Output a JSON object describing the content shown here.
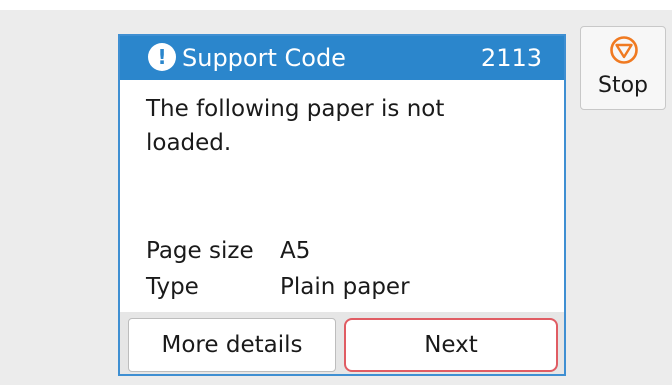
{
  "dialog": {
    "title": "Support Code",
    "code": "2113",
    "message": "The following paper is not loaded.",
    "details": [
      {
        "label": "Page size",
        "value": "A5"
      },
      {
        "label": "Type",
        "value": "Plain paper"
      }
    ],
    "buttons": {
      "more_details": "More details",
      "next": "Next"
    }
  },
  "stop": {
    "label": "Stop"
  },
  "icons": {
    "title": "exclamation-icon",
    "stop": "stop-icon"
  },
  "colors": {
    "title_bar": "#2b86cc",
    "highlight": "#e05c63",
    "stop_icon": "#f07a21"
  }
}
